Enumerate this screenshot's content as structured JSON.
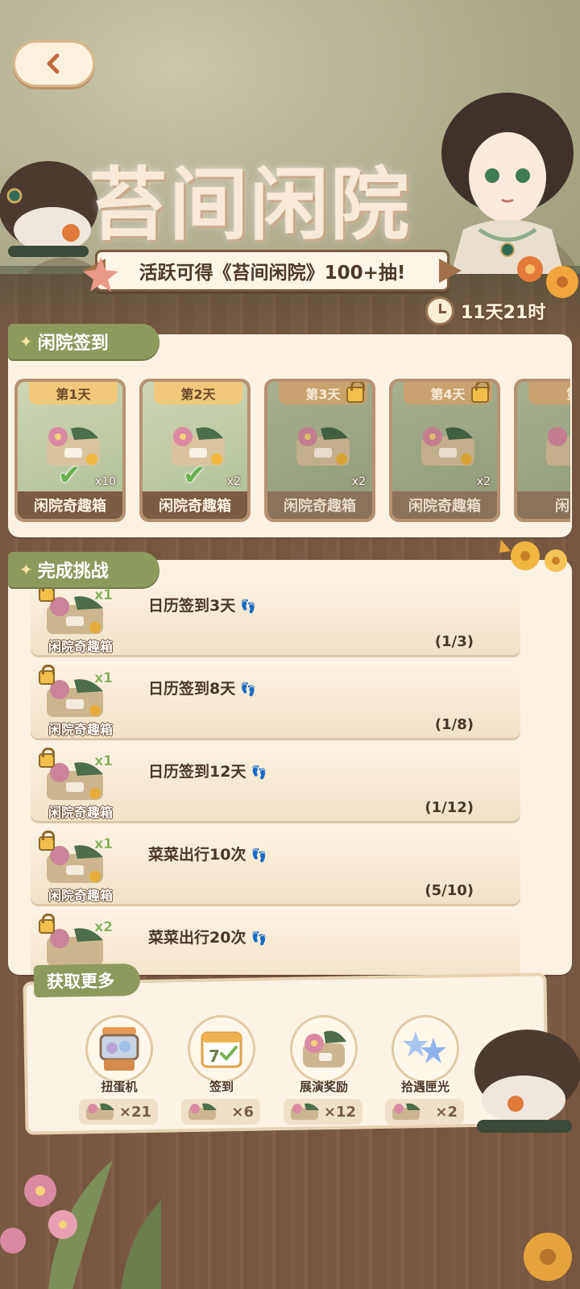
{
  "header": {
    "title": "苔间闲院",
    "banner": "活跃可得《苔间闲院》100+抽!",
    "timer": "11天21时"
  },
  "sign_in": {
    "section_title": "闲院签到",
    "days": [
      {
        "label": "第1天",
        "item": "闲院奇趣箱",
        "qty": "x10",
        "claimed": true,
        "locked": false
      },
      {
        "label": "第2天",
        "item": "闲院奇趣箱",
        "qty": "x2",
        "claimed": true,
        "locked": false
      },
      {
        "label": "第3天",
        "item": "闲院奇趣箱",
        "qty": "x2",
        "claimed": false,
        "locked": true
      },
      {
        "label": "第4天",
        "item": "闲院奇趣箱",
        "qty": "x2",
        "claimed": false,
        "locked": true
      },
      {
        "label": "第",
        "item": "闲院",
        "qty": "",
        "claimed": false,
        "locked": true
      }
    ]
  },
  "challenges": {
    "section_title": "完成挑战",
    "items": [
      {
        "title": "日历签到3天",
        "progress": "(1/3)",
        "reward": "闲院奇趣箱",
        "qty": "x1"
      },
      {
        "title": "日历签到8天",
        "progress": "(1/8)",
        "reward": "闲院奇趣箱",
        "qty": "x1"
      },
      {
        "title": "日历签到12天",
        "progress": "(1/12)",
        "reward": "闲院奇趣箱",
        "qty": "x1"
      },
      {
        "title": "菜菜出行10次",
        "progress": "(5/10)",
        "reward": "闲院奇趣箱",
        "qty": "x1"
      },
      {
        "title": "菜菜出行20次",
        "progress": "",
        "reward": "",
        "qty": "x2"
      }
    ]
  },
  "get_more": {
    "section_title": "获取更多",
    "sources": [
      {
        "name": "扭蛋机",
        "count": "×21",
        "icon": "gacha-machine-icon"
      },
      {
        "name": "签到",
        "count": "×6",
        "icon": "calendar-icon"
      },
      {
        "name": "展演奖励",
        "count": "×12",
        "icon": "reward-box-icon"
      },
      {
        "name": "拾遇匣光",
        "count": "×2",
        "icon": "blue-flowers-icon"
      }
    ]
  },
  "colors": {
    "accent_green": "#8d9a5e",
    "panel_cream": "#fbf2e2",
    "wood_brown": "#7b5a44"
  }
}
